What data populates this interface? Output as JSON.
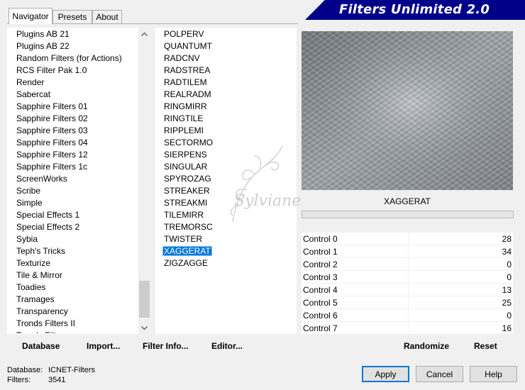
{
  "tabs": [
    {
      "label": "Navigator"
    },
    {
      "label": "Presets"
    },
    {
      "label": "About"
    }
  ],
  "banner": {
    "title": "Filters Unlimited 2.0"
  },
  "categories": [
    "Plugins AB 21",
    "Plugins AB 22",
    "Random Filters (for Actions)",
    "RCS Filter Pak 1.0",
    "Render",
    "Sabercat",
    "Sapphire Filters 01",
    "Sapphire Filters 02",
    "Sapphire Filters 03",
    "Sapphire Filters 04",
    "Sapphire Filters 12",
    "Sapphire Filters 1c",
    "ScreenWorks",
    "Scribe",
    "Simple",
    "Special Effects 1",
    "Special Effects 2",
    "Sybia",
    "Teph's Tricks",
    "Texturize",
    "Tile & Mirror",
    "Toadies",
    "Tramages",
    "Transparency",
    "Tronds Filters II",
    "Tronds Filters"
  ],
  "filters": [
    "POLPERV",
    "QUANTUMT",
    "RADCNV",
    "RADSTREA",
    "RADTILEM",
    "REALRADM",
    "RINGMIRR",
    "RINGTILE",
    "RIPPLEMI",
    "SECTORMO",
    "SIERPENS",
    "SINGULAR",
    "SPYROZAG",
    "STREAKER",
    "STREAKMI",
    "TILEMIRR",
    "TREMORSC",
    "TWISTER",
    "XAGGERAT",
    "ZIGZAGGE"
  ],
  "selected_filter": "XAGGERAT",
  "selected_category": "Sybia",
  "filter_name_display": "XAGGERAT",
  "controls": [
    {
      "label": "Control 0",
      "value": "28"
    },
    {
      "label": "Control 1",
      "value": "34"
    },
    {
      "label": "Control 2",
      "value": "0"
    },
    {
      "label": "Control 3",
      "value": "0"
    },
    {
      "label": "Control 4",
      "value": "13"
    },
    {
      "label": "Control 5",
      "value": "25"
    },
    {
      "label": "Control 6",
      "value": "0"
    },
    {
      "label": "Control 7",
      "value": "16"
    }
  ],
  "toolbar": {
    "database": "Database",
    "import": "Import...",
    "filter_info": "Filter Info...",
    "editor": "Editor...",
    "randomize": "Randomize",
    "reset": "Reset"
  },
  "buttons": {
    "apply": "Apply",
    "cancel": "Cancel",
    "help": "Help"
  },
  "status": {
    "database_label": "Database:",
    "database_value": "ICNET-Filters",
    "filters_label": "Filters:",
    "filters_value": "3541"
  },
  "watermark": "Sylviane",
  "icons": {
    "scroll_up": "chevron-up-icon",
    "scroll_down": "chevron-down-icon"
  },
  "colors": {
    "accent": "#00008b",
    "selection": "#0078d7"
  }
}
